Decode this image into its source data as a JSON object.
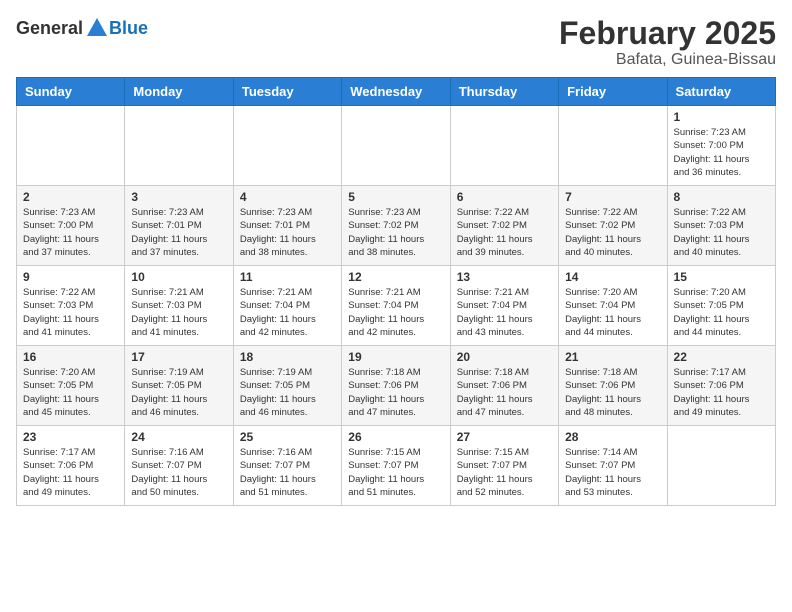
{
  "header": {
    "logo_general": "General",
    "logo_blue": "Blue",
    "month_title": "February 2025",
    "location": "Bafata, Guinea-Bissau"
  },
  "calendar": {
    "days_of_week": [
      "Sunday",
      "Monday",
      "Tuesday",
      "Wednesday",
      "Thursday",
      "Friday",
      "Saturday"
    ],
    "weeks": [
      [
        {
          "day": "",
          "info": ""
        },
        {
          "day": "",
          "info": ""
        },
        {
          "day": "",
          "info": ""
        },
        {
          "day": "",
          "info": ""
        },
        {
          "day": "",
          "info": ""
        },
        {
          "day": "",
          "info": ""
        },
        {
          "day": "1",
          "info": "Sunrise: 7:23 AM\nSunset: 7:00 PM\nDaylight: 11 hours\nand 36 minutes."
        }
      ],
      [
        {
          "day": "2",
          "info": "Sunrise: 7:23 AM\nSunset: 7:00 PM\nDaylight: 11 hours\nand 37 minutes."
        },
        {
          "day": "3",
          "info": "Sunrise: 7:23 AM\nSunset: 7:01 PM\nDaylight: 11 hours\nand 37 minutes."
        },
        {
          "day": "4",
          "info": "Sunrise: 7:23 AM\nSunset: 7:01 PM\nDaylight: 11 hours\nand 38 minutes."
        },
        {
          "day": "5",
          "info": "Sunrise: 7:23 AM\nSunset: 7:02 PM\nDaylight: 11 hours\nand 38 minutes."
        },
        {
          "day": "6",
          "info": "Sunrise: 7:22 AM\nSunset: 7:02 PM\nDaylight: 11 hours\nand 39 minutes."
        },
        {
          "day": "7",
          "info": "Sunrise: 7:22 AM\nSunset: 7:02 PM\nDaylight: 11 hours\nand 40 minutes."
        },
        {
          "day": "8",
          "info": "Sunrise: 7:22 AM\nSunset: 7:03 PM\nDaylight: 11 hours\nand 40 minutes."
        }
      ],
      [
        {
          "day": "9",
          "info": "Sunrise: 7:22 AM\nSunset: 7:03 PM\nDaylight: 11 hours\nand 41 minutes."
        },
        {
          "day": "10",
          "info": "Sunrise: 7:21 AM\nSunset: 7:03 PM\nDaylight: 11 hours\nand 41 minutes."
        },
        {
          "day": "11",
          "info": "Sunrise: 7:21 AM\nSunset: 7:04 PM\nDaylight: 11 hours\nand 42 minutes."
        },
        {
          "day": "12",
          "info": "Sunrise: 7:21 AM\nSunset: 7:04 PM\nDaylight: 11 hours\nand 42 minutes."
        },
        {
          "day": "13",
          "info": "Sunrise: 7:21 AM\nSunset: 7:04 PM\nDaylight: 11 hours\nand 43 minutes."
        },
        {
          "day": "14",
          "info": "Sunrise: 7:20 AM\nSunset: 7:04 PM\nDaylight: 11 hours\nand 44 minutes."
        },
        {
          "day": "15",
          "info": "Sunrise: 7:20 AM\nSunset: 7:05 PM\nDaylight: 11 hours\nand 44 minutes."
        }
      ],
      [
        {
          "day": "16",
          "info": "Sunrise: 7:20 AM\nSunset: 7:05 PM\nDaylight: 11 hours\nand 45 minutes."
        },
        {
          "day": "17",
          "info": "Sunrise: 7:19 AM\nSunset: 7:05 PM\nDaylight: 11 hours\nand 46 minutes."
        },
        {
          "day": "18",
          "info": "Sunrise: 7:19 AM\nSunset: 7:05 PM\nDaylight: 11 hours\nand 46 minutes."
        },
        {
          "day": "19",
          "info": "Sunrise: 7:18 AM\nSunset: 7:06 PM\nDaylight: 11 hours\nand 47 minutes."
        },
        {
          "day": "20",
          "info": "Sunrise: 7:18 AM\nSunset: 7:06 PM\nDaylight: 11 hours\nand 47 minutes."
        },
        {
          "day": "21",
          "info": "Sunrise: 7:18 AM\nSunset: 7:06 PM\nDaylight: 11 hours\nand 48 minutes."
        },
        {
          "day": "22",
          "info": "Sunrise: 7:17 AM\nSunset: 7:06 PM\nDaylight: 11 hours\nand 49 minutes."
        }
      ],
      [
        {
          "day": "23",
          "info": "Sunrise: 7:17 AM\nSunset: 7:06 PM\nDaylight: 11 hours\nand 49 minutes."
        },
        {
          "day": "24",
          "info": "Sunrise: 7:16 AM\nSunset: 7:07 PM\nDaylight: 11 hours\nand 50 minutes."
        },
        {
          "day": "25",
          "info": "Sunrise: 7:16 AM\nSunset: 7:07 PM\nDaylight: 11 hours\nand 51 minutes."
        },
        {
          "day": "26",
          "info": "Sunrise: 7:15 AM\nSunset: 7:07 PM\nDaylight: 11 hours\nand 51 minutes."
        },
        {
          "day": "27",
          "info": "Sunrise: 7:15 AM\nSunset: 7:07 PM\nDaylight: 11 hours\nand 52 minutes."
        },
        {
          "day": "28",
          "info": "Sunrise: 7:14 AM\nSunset: 7:07 PM\nDaylight: 11 hours\nand 53 minutes."
        },
        {
          "day": "",
          "info": ""
        }
      ]
    ]
  }
}
